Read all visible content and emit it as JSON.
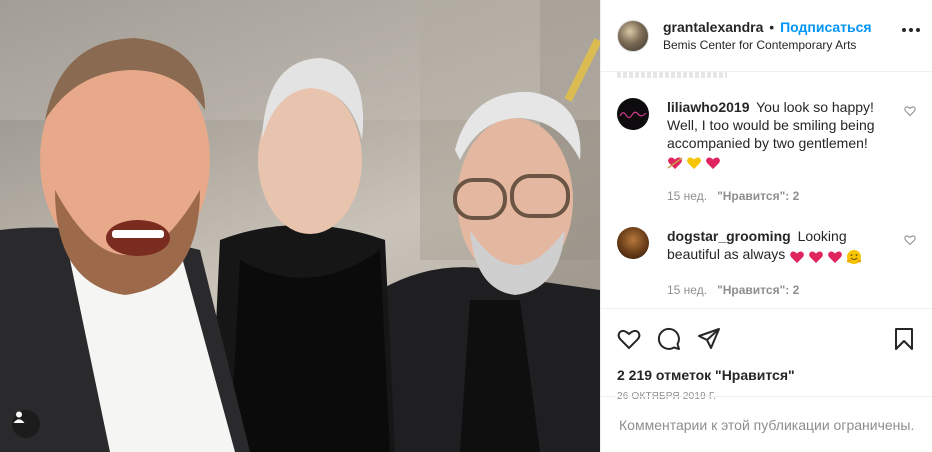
{
  "header": {
    "username": "grantalexandra",
    "separator": "•",
    "follow_label": "Подписаться",
    "location": "Bemis Center for Contemporary Arts"
  },
  "comments": [
    {
      "username": "liliawho2019",
      "text": "You look so happy! Well, I too would be smiling being accompanied by two gentlemen!",
      "emojis": [
        "heart-with-arrow",
        "yellow-heart",
        "red-heart"
      ],
      "time": "15 нед.",
      "likes_label": "\"Нравится\": 2"
    },
    {
      "username": "dogstar_grooming",
      "text": "Looking beautiful as always",
      "emojis": [
        "red-heart",
        "red-heart",
        "red-heart",
        "hugging-face"
      ],
      "time": "15 нед.",
      "likes_label": "\"Нравится\": 2"
    }
  ],
  "actions": {
    "likes_text": "2 219 отметок \"Нравится\"",
    "date": "26 ОКТЯБРЯ 2019 Г."
  },
  "footer": {
    "comments_limited": "Комментарии к этой публикации ограничены."
  },
  "colors": {
    "link": "#0095f6",
    "muted": "#8e8e8e",
    "text": "#262626",
    "border": "#efefef"
  }
}
